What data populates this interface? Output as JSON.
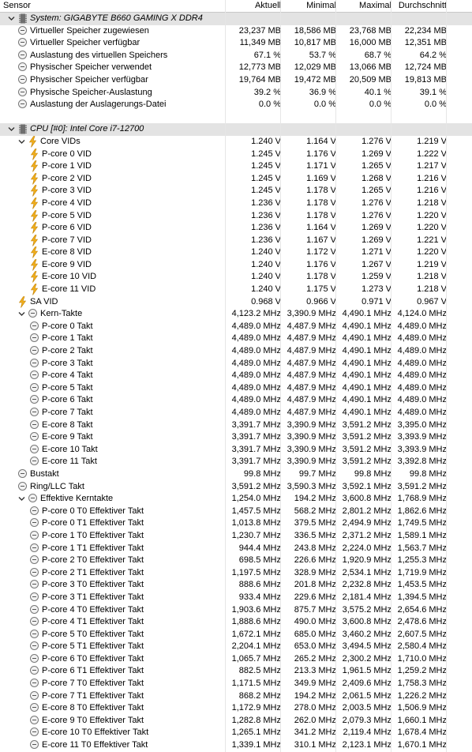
{
  "header": {
    "sensor": "Sensor",
    "current": "Aktuell",
    "min": "Minimal",
    "max": "Maximal",
    "avg": "Durchschnitt"
  },
  "rows": [
    {
      "kind": "group",
      "indent": 0,
      "icon": "chip-icon",
      "name": "System: GIGABYTE B660 GAMING X DDR4",
      "cur": "",
      "min": "",
      "max": "",
      "avg": ""
    },
    {
      "kind": "sensor",
      "indent": 1,
      "icon": "circle-icon",
      "name": "Virtueller Speicher zugewiesen",
      "cur": "23,237 MB",
      "min": "18,586 MB",
      "max": "23,768 MB",
      "avg": "22,234 MB"
    },
    {
      "kind": "sensor",
      "indent": 1,
      "icon": "circle-icon",
      "name": "Virtueller Speicher verfügbar",
      "cur": "11,349 MB",
      "min": "10,817 MB",
      "max": "16,000 MB",
      "avg": "12,351 MB"
    },
    {
      "kind": "sensor",
      "indent": 1,
      "icon": "circle-icon",
      "name": "Auslastung des virtuellen Speichers",
      "cur": "67.1 %",
      "min": "53.7 %",
      "max": "68.7 %",
      "avg": "64.2 %"
    },
    {
      "kind": "sensor",
      "indent": 1,
      "icon": "circle-icon",
      "name": "Physischer Speicher verwendet",
      "cur": "12,773 MB",
      "min": "12,029 MB",
      "max": "13,066 MB",
      "avg": "12,724 MB"
    },
    {
      "kind": "sensor",
      "indent": 1,
      "icon": "circle-icon",
      "name": "Physischer Speicher verfügbar",
      "cur": "19,764 MB",
      "min": "19,472 MB",
      "max": "20,509 MB",
      "avg": "19,813 MB"
    },
    {
      "kind": "sensor",
      "indent": 1,
      "icon": "circle-icon",
      "name": "Physische Speicher-Auslastung",
      "cur": "39.2 %",
      "min": "36.9 %",
      "max": "40.1 %",
      "avg": "39.1 %"
    },
    {
      "kind": "sensor",
      "indent": 1,
      "icon": "circle-icon",
      "name": "Auslastung der Auslagerungs-Datei",
      "cur": "0.0 %",
      "min": "0.0 %",
      "max": "0.0 %",
      "avg": "0.0 %"
    },
    {
      "kind": "blank",
      "indent": 0,
      "icon": "",
      "name": "",
      "cur": "",
      "min": "",
      "max": "",
      "avg": ""
    },
    {
      "kind": "group",
      "indent": 0,
      "icon": "chip-icon",
      "name": "CPU [#0]: Intel Core i7-12700",
      "cur": "",
      "min": "",
      "max": "",
      "avg": ""
    },
    {
      "kind": "sub",
      "indent": 1,
      "icon": "bolt-icon",
      "name": "Core VIDs",
      "cur": "1.240 V",
      "min": "1.164 V",
      "max": "1.276 V",
      "avg": "1.219 V"
    },
    {
      "kind": "sensor",
      "indent": 2,
      "icon": "bolt-icon",
      "name": "P-core 0 VID",
      "cur": "1.245 V",
      "min": "1.176 V",
      "max": "1.269 V",
      "avg": "1.222 V"
    },
    {
      "kind": "sensor",
      "indent": 2,
      "icon": "bolt-icon",
      "name": "P-core 1 VID",
      "cur": "1.245 V",
      "min": "1.171 V",
      "max": "1.265 V",
      "avg": "1.217 V"
    },
    {
      "kind": "sensor",
      "indent": 2,
      "icon": "bolt-icon",
      "name": "P-core 2 VID",
      "cur": "1.245 V",
      "min": "1.169 V",
      "max": "1.268 V",
      "avg": "1.216 V"
    },
    {
      "kind": "sensor",
      "indent": 2,
      "icon": "bolt-icon",
      "name": "P-core 3 VID",
      "cur": "1.245 V",
      "min": "1.178 V",
      "max": "1.265 V",
      "avg": "1.216 V"
    },
    {
      "kind": "sensor",
      "indent": 2,
      "icon": "bolt-icon",
      "name": "P-core 4 VID",
      "cur": "1.236 V",
      "min": "1.178 V",
      "max": "1.276 V",
      "avg": "1.218 V"
    },
    {
      "kind": "sensor",
      "indent": 2,
      "icon": "bolt-icon",
      "name": "P-core 5 VID",
      "cur": "1.236 V",
      "min": "1.178 V",
      "max": "1.276 V",
      "avg": "1.220 V"
    },
    {
      "kind": "sensor",
      "indent": 2,
      "icon": "bolt-icon",
      "name": "P-core 6 VID",
      "cur": "1.236 V",
      "min": "1.164 V",
      "max": "1.269 V",
      "avg": "1.220 V"
    },
    {
      "kind": "sensor",
      "indent": 2,
      "icon": "bolt-icon",
      "name": "P-core 7 VID",
      "cur": "1.236 V",
      "min": "1.167 V",
      "max": "1.269 V",
      "avg": "1.221 V"
    },
    {
      "kind": "sensor",
      "indent": 2,
      "icon": "bolt-icon",
      "name": "E-core 8 VID",
      "cur": "1.240 V",
      "min": "1.172 V",
      "max": "1.271 V",
      "avg": "1.220 V"
    },
    {
      "kind": "sensor",
      "indent": 2,
      "icon": "bolt-icon",
      "name": "E-core 9 VID",
      "cur": "1.240 V",
      "min": "1.176 V",
      "max": "1.267 V",
      "avg": "1.219 V"
    },
    {
      "kind": "sensor",
      "indent": 2,
      "icon": "bolt-icon",
      "name": "E-core 10 VID",
      "cur": "1.240 V",
      "min": "1.178 V",
      "max": "1.259 V",
      "avg": "1.218 V"
    },
    {
      "kind": "sensor",
      "indent": 2,
      "icon": "bolt-icon",
      "name": "E-core 11 VID",
      "cur": "1.240 V",
      "min": "1.175 V",
      "max": "1.273 V",
      "avg": "1.218 V"
    },
    {
      "kind": "sensor",
      "indent": 1,
      "icon": "bolt-icon",
      "name": "SA VID",
      "cur": "0.968 V",
      "min": "0.966 V",
      "max": "0.971 V",
      "avg": "0.967 V"
    },
    {
      "kind": "sub",
      "indent": 1,
      "icon": "circle-icon",
      "name": "Kern-Takte",
      "cur": "4,123.2 MHz",
      "min": "3,390.9 MHz",
      "max": "4,490.1 MHz",
      "avg": "4,124.0 MHz"
    },
    {
      "kind": "sensor",
      "indent": 2,
      "icon": "circle-icon",
      "name": "P-core 0 Takt",
      "cur": "4,489.0 MHz",
      "min": "4,487.9 MHz",
      "max": "4,490.1 MHz",
      "avg": "4,489.0 MHz"
    },
    {
      "kind": "sensor",
      "indent": 2,
      "icon": "circle-icon",
      "name": "P-core 1 Takt",
      "cur": "4,489.0 MHz",
      "min": "4,487.9 MHz",
      "max": "4,490.1 MHz",
      "avg": "4,489.0 MHz"
    },
    {
      "kind": "sensor",
      "indent": 2,
      "icon": "circle-icon",
      "name": "P-core 2 Takt",
      "cur": "4,489.0 MHz",
      "min": "4,487.9 MHz",
      "max": "4,490.1 MHz",
      "avg": "4,489.0 MHz"
    },
    {
      "kind": "sensor",
      "indent": 2,
      "icon": "circle-icon",
      "name": "P-core 3 Takt",
      "cur": "4,489.0 MHz",
      "min": "4,487.9 MHz",
      "max": "4,490.1 MHz",
      "avg": "4,489.0 MHz"
    },
    {
      "kind": "sensor",
      "indent": 2,
      "icon": "circle-icon",
      "name": "P-core 4 Takt",
      "cur": "4,489.0 MHz",
      "min": "4,487.9 MHz",
      "max": "4,490.1 MHz",
      "avg": "4,489.0 MHz"
    },
    {
      "kind": "sensor",
      "indent": 2,
      "icon": "circle-icon",
      "name": "P-core 5 Takt",
      "cur": "4,489.0 MHz",
      "min": "4,487.9 MHz",
      "max": "4,490.1 MHz",
      "avg": "4,489.0 MHz"
    },
    {
      "kind": "sensor",
      "indent": 2,
      "icon": "circle-icon",
      "name": "P-core 6 Takt",
      "cur": "4,489.0 MHz",
      "min": "4,487.9 MHz",
      "max": "4,490.1 MHz",
      "avg": "4,489.0 MHz"
    },
    {
      "kind": "sensor",
      "indent": 2,
      "icon": "circle-icon",
      "name": "P-core 7 Takt",
      "cur": "4,489.0 MHz",
      "min": "4,487.9 MHz",
      "max": "4,490.1 MHz",
      "avg": "4,489.0 MHz"
    },
    {
      "kind": "sensor",
      "indent": 2,
      "icon": "circle-icon",
      "name": "E-core 8 Takt",
      "cur": "3,391.7 MHz",
      "min": "3,390.9 MHz",
      "max": "3,591.2 MHz",
      "avg": "3,395.0 MHz"
    },
    {
      "kind": "sensor",
      "indent": 2,
      "icon": "circle-icon",
      "name": "E-core 9 Takt",
      "cur": "3,391.7 MHz",
      "min": "3,390.9 MHz",
      "max": "3,591.2 MHz",
      "avg": "3,393.9 MHz"
    },
    {
      "kind": "sensor",
      "indent": 2,
      "icon": "circle-icon",
      "name": "E-core 10 Takt",
      "cur": "3,391.7 MHz",
      "min": "3,390.9 MHz",
      "max": "3,591.2 MHz",
      "avg": "3,393.9 MHz"
    },
    {
      "kind": "sensor",
      "indent": 2,
      "icon": "circle-icon",
      "name": "E-core 11 Takt",
      "cur": "3,391.7 MHz",
      "min": "3,390.9 MHz",
      "max": "3,591.2 MHz",
      "avg": "3,392.8 MHz"
    },
    {
      "kind": "sensor",
      "indent": 1,
      "icon": "circle-icon",
      "name": "Bustakt",
      "cur": "99.8 MHz",
      "min": "99.7 MHz",
      "max": "99.8 MHz",
      "avg": "99.8 MHz"
    },
    {
      "kind": "sensor",
      "indent": 1,
      "icon": "circle-icon",
      "name": "Ring/LLC Takt",
      "cur": "3,591.2 MHz",
      "min": "3,590.3 MHz",
      "max": "3,592.1 MHz",
      "avg": "3,591.2 MHz"
    },
    {
      "kind": "sub",
      "indent": 1,
      "icon": "circle-icon",
      "name": "Effektive Kerntakte",
      "cur": "1,254.0 MHz",
      "min": "194.2 MHz",
      "max": "3,600.8 MHz",
      "avg": "1,768.9 MHz"
    },
    {
      "kind": "sensor",
      "indent": 2,
      "icon": "circle-icon",
      "name": "P-core 0 T0 Effektiver Takt",
      "cur": "1,457.5 MHz",
      "min": "568.2 MHz",
      "max": "2,801.2 MHz",
      "avg": "1,862.6 MHz"
    },
    {
      "kind": "sensor",
      "indent": 2,
      "icon": "circle-icon",
      "name": "P-core 0 T1 Effektiver Takt",
      "cur": "1,013.8 MHz",
      "min": "379.5 MHz",
      "max": "2,494.9 MHz",
      "avg": "1,749.5 MHz"
    },
    {
      "kind": "sensor",
      "indent": 2,
      "icon": "circle-icon",
      "name": "P-core 1 T0 Effektiver Takt",
      "cur": "1,230.7 MHz",
      "min": "336.5 MHz",
      "max": "2,371.2 MHz",
      "avg": "1,589.1 MHz"
    },
    {
      "kind": "sensor",
      "indent": 2,
      "icon": "circle-icon",
      "name": "P-core 1 T1 Effektiver Takt",
      "cur": "944.4 MHz",
      "min": "243.8 MHz",
      "max": "2,224.0 MHz",
      "avg": "1,563.7 MHz"
    },
    {
      "kind": "sensor",
      "indent": 2,
      "icon": "circle-icon",
      "name": "P-core 2 T0 Effektiver Takt",
      "cur": "698.5 MHz",
      "min": "226.6 MHz",
      "max": "1,920.9 MHz",
      "avg": "1,255.3 MHz"
    },
    {
      "kind": "sensor",
      "indent": 2,
      "icon": "circle-icon",
      "name": "P-core 2 T1 Effektiver Takt",
      "cur": "1,197.5 MHz",
      "min": "328.9 MHz",
      "max": "2,534.1 MHz",
      "avg": "1,719.9 MHz"
    },
    {
      "kind": "sensor",
      "indent": 2,
      "icon": "circle-icon",
      "name": "P-core 3 T0 Effektiver Takt",
      "cur": "888.6 MHz",
      "min": "201.8 MHz",
      "max": "2,232.8 MHz",
      "avg": "1,453.5 MHz"
    },
    {
      "kind": "sensor",
      "indent": 2,
      "icon": "circle-icon",
      "name": "P-core 3 T1 Effektiver Takt",
      "cur": "933.4 MHz",
      "min": "229.6 MHz",
      "max": "2,181.4 MHz",
      "avg": "1,394.5 MHz"
    },
    {
      "kind": "sensor",
      "indent": 2,
      "icon": "circle-icon",
      "name": "P-core 4 T0 Effektiver Takt",
      "cur": "1,903.6 MHz",
      "min": "875.7 MHz",
      "max": "3,575.2 MHz",
      "avg": "2,654.6 MHz"
    },
    {
      "kind": "sensor",
      "indent": 2,
      "icon": "circle-icon",
      "name": "P-core 4 T1 Effektiver Takt",
      "cur": "1,888.6 MHz",
      "min": "490.0 MHz",
      "max": "3,600.8 MHz",
      "avg": "2,478.6 MHz"
    },
    {
      "kind": "sensor",
      "indent": 2,
      "icon": "circle-icon",
      "name": "P-core 5 T0 Effektiver Takt",
      "cur": "1,672.1 MHz",
      "min": "685.0 MHz",
      "max": "3,460.2 MHz",
      "avg": "2,607.5 MHz"
    },
    {
      "kind": "sensor",
      "indent": 2,
      "icon": "circle-icon",
      "name": "P-core 5 T1 Effektiver Takt",
      "cur": "2,204.1 MHz",
      "min": "653.0 MHz",
      "max": "3,494.5 MHz",
      "avg": "2,580.4 MHz"
    },
    {
      "kind": "sensor",
      "indent": 2,
      "icon": "circle-icon",
      "name": "P-core 6 T0 Effektiver Takt",
      "cur": "1,065.7 MHz",
      "min": "265.2 MHz",
      "max": "2,300.2 MHz",
      "avg": "1,710.0 MHz"
    },
    {
      "kind": "sensor",
      "indent": 2,
      "icon": "circle-icon",
      "name": "P-core 6 T1 Effektiver Takt",
      "cur": "882.5 MHz",
      "min": "213.3 MHz",
      "max": "1,961.5 MHz",
      "avg": "1,259.2 MHz"
    },
    {
      "kind": "sensor",
      "indent": 2,
      "icon": "circle-icon",
      "name": "P-core 7 T0 Effektiver Takt",
      "cur": "1,171.5 MHz",
      "min": "349.9 MHz",
      "max": "2,409.6 MHz",
      "avg": "1,758.3 MHz"
    },
    {
      "kind": "sensor",
      "indent": 2,
      "icon": "circle-icon",
      "name": "P-core 7 T1 Effektiver Takt",
      "cur": "868.2 MHz",
      "min": "194.2 MHz",
      "max": "2,061.5 MHz",
      "avg": "1,226.2 MHz"
    },
    {
      "kind": "sensor",
      "indent": 2,
      "icon": "circle-icon",
      "name": "E-core 8 T0 Effektiver Takt",
      "cur": "1,172.9 MHz",
      "min": "278.0 MHz",
      "max": "2,003.5 MHz",
      "avg": "1,506.9 MHz"
    },
    {
      "kind": "sensor",
      "indent": 2,
      "icon": "circle-icon",
      "name": "E-core 9 T0 Effektiver Takt",
      "cur": "1,282.8 MHz",
      "min": "262.0 MHz",
      "max": "2,079.3 MHz",
      "avg": "1,660.1 MHz"
    },
    {
      "kind": "sensor",
      "indent": 2,
      "icon": "circle-icon",
      "name": "E-core 10 T0 Effektiver Takt",
      "cur": "1,265.1 MHz",
      "min": "341.2 MHz",
      "max": "2,119.4 MHz",
      "avg": "1,678.4 MHz"
    },
    {
      "kind": "sensor",
      "indent": 2,
      "icon": "circle-icon",
      "name": "E-core 11 T0 Effektiver Takt",
      "cur": "1,339.1 MHz",
      "min": "310.1 MHz",
      "max": "2,123.1 MHz",
      "avg": "1,670.1 MHz"
    }
  ]
}
